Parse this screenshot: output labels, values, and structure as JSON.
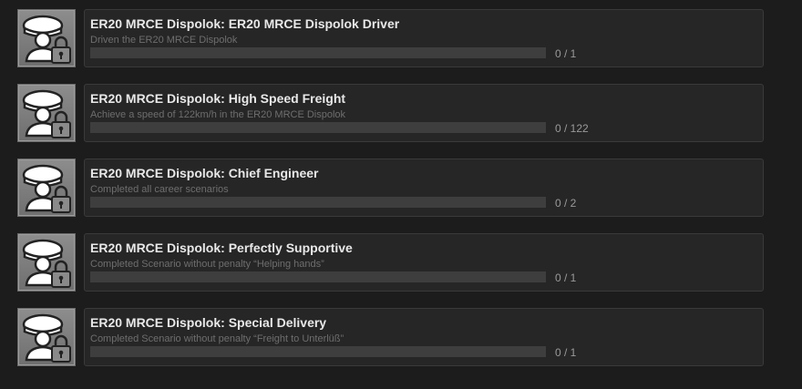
{
  "achievements": [
    {
      "title": "ER20 MRCE Dispolok: ER20 MRCE Dispolok Driver",
      "description": "Driven the ER20 MRCE Dispolok",
      "progress_text": "0 / 1",
      "current": 0,
      "total": 1,
      "icon": "locked-driver-cap-icon"
    },
    {
      "title": "ER20 MRCE Dispolok: High Speed Freight",
      "description": "Achieve a speed of 122km/h in the ER20 MRCE Dispolok",
      "progress_text": "0 / 122",
      "current": 0,
      "total": 122,
      "icon": "locked-driver-cap-icon"
    },
    {
      "title": "ER20 MRCE Dispolok: Chief Engineer",
      "description": "Completed all career scenarios",
      "progress_text": "0 / 2",
      "current": 0,
      "total": 2,
      "icon": "locked-driver-cap-icon"
    },
    {
      "title": "ER20 MRCE Dispolok: Perfectly Supportive",
      "description": "Completed Scenario without penalty “Helping hands”",
      "progress_text": "0 / 1",
      "current": 0,
      "total": 1,
      "icon": "locked-driver-cap-icon"
    },
    {
      "title": "ER20 MRCE Dispolok: Special Delivery",
      "description": "Completed Scenario without penalty “Freight to Unterlüß”",
      "progress_text": "0 / 1",
      "current": 0,
      "total": 1,
      "icon": "locked-driver-cap-icon"
    }
  ],
  "colors": {
    "background": "#1c1c1c",
    "card": "#262626",
    "bar_track": "#3e3e3e",
    "title": "#e8e8e8",
    "description": "#6e6e6e"
  }
}
